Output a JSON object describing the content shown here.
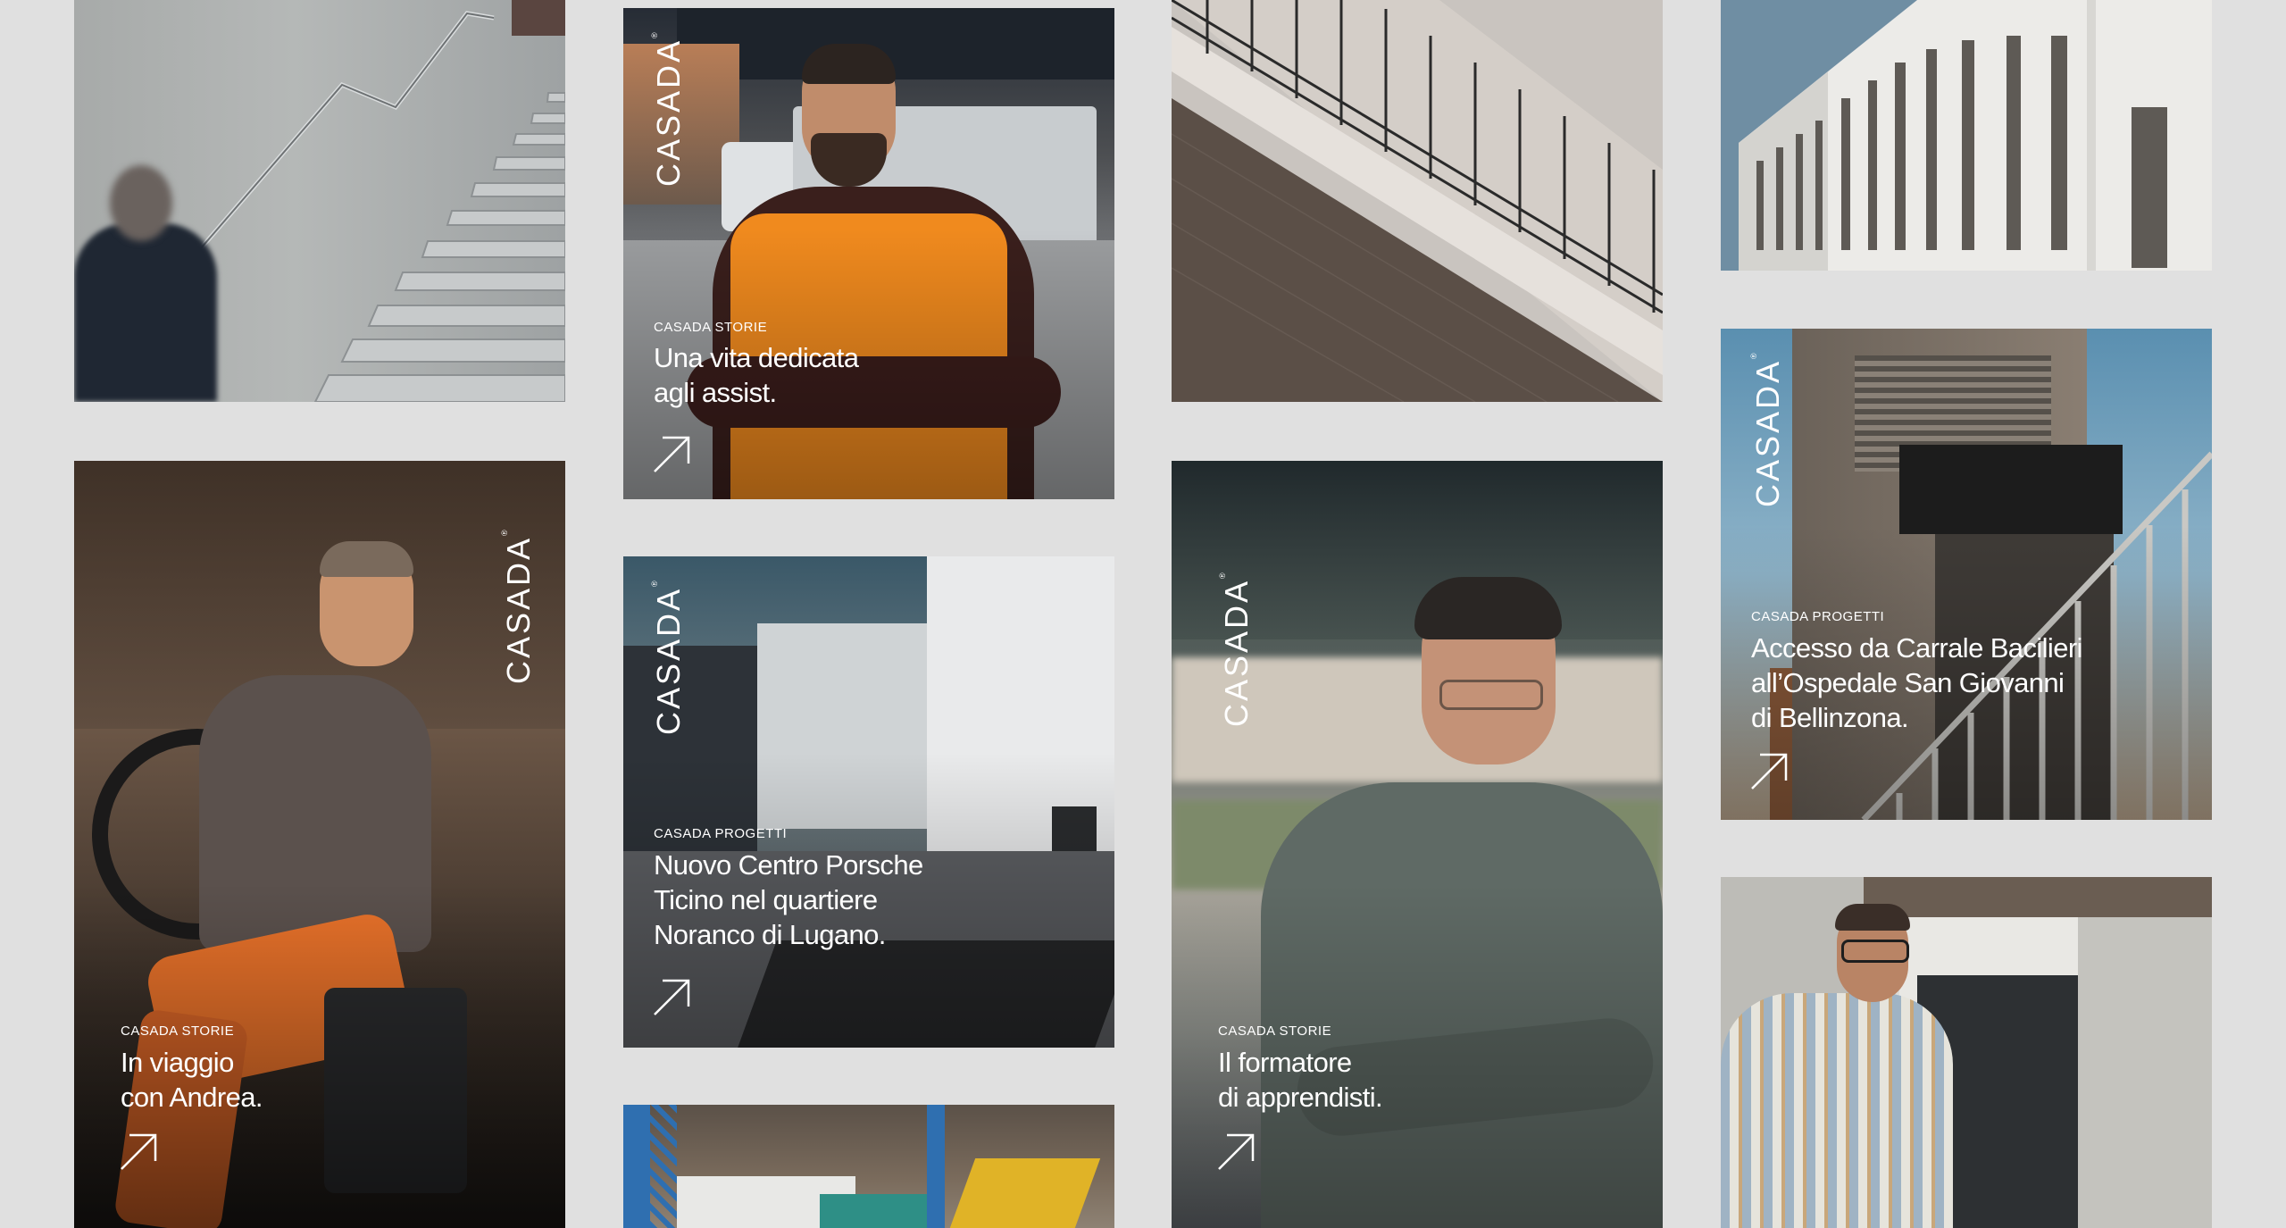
{
  "brand": {
    "name": "CASADA",
    "mark": "®"
  },
  "colors": {
    "page_bg": "#e0e0e0",
    "text_on_image": "#ffffff",
    "vest_orange": "#f08a1e",
    "trousers_orange": "#e9722a"
  },
  "cards": {
    "storie_1": {
      "kicker": "CASADA STORIE",
      "title_lines": [
        "Una vita dedicata",
        "agli assist."
      ],
      "icon": "arrow-up-right-icon"
    },
    "progetti_porsche": {
      "kicker": "CASADA PROGETTI",
      "title_lines": [
        "Nuovo Centro Porsche",
        "Ticino nel quartiere",
        "Noranco di Lugano."
      ],
      "icon": "arrow-up-right-icon"
    },
    "storie_andrea": {
      "kicker": "CASADA STORIE",
      "title_lines": [
        "In viaggio",
        "con Andrea."
      ],
      "icon": "arrow-up-right-icon"
    },
    "storie_formatore": {
      "kicker": "CASADA STORIE",
      "title_lines": [
        "Il formatore",
        "di apprendisti."
      ],
      "icon": "arrow-up-right-icon"
    },
    "progetti_ospedale": {
      "kicker": "CASADA PROGETTI",
      "title_lines": [
        "Accesso da Carrale Bacilieri",
        "all’Ospedale San Giovanni",
        "di Bellinzona."
      ],
      "icon": "arrow-up-right-icon"
    }
  },
  "images": {
    "staircase": "concrete-staircase-photo",
    "railing": "railing-diagonal-photo",
    "facade": "white-facade-photo",
    "construction": "construction-site-photo",
    "man_glasses": "man-checked-shirt-photo"
  }
}
